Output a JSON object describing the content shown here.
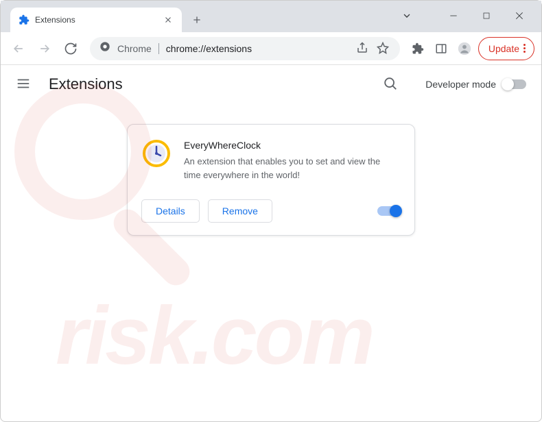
{
  "browser": {
    "tab_title": "Extensions",
    "omnibox_prefix": "Chrome",
    "omnibox_url": "chrome://extensions",
    "update_label": "Update"
  },
  "page": {
    "title": "Extensions",
    "dev_mode_label": "Developer mode",
    "dev_mode_on": false
  },
  "extension": {
    "name": "EveryWhereClock",
    "description": "An extension that enables you to set and view the time everywhere in the world!",
    "enabled": true,
    "details_label": "Details",
    "remove_label": "Remove"
  },
  "watermark_text": "risk.com"
}
